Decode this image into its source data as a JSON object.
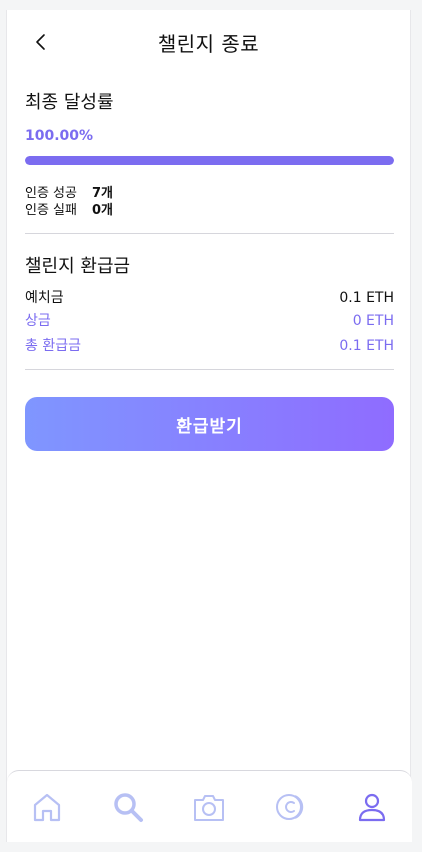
{
  "header": {
    "title": "챌린지 종료"
  },
  "achievement": {
    "heading": "최종 달성률",
    "percent_text": "100.00%",
    "progress_fraction": 1.0,
    "success_label": "인증 성공",
    "success_value": "7개",
    "fail_label": "인증 실패",
    "fail_value": "0개"
  },
  "refund": {
    "heading": "챌린지 환급금",
    "deposit_label": "예치금",
    "deposit_value": "0.1 ETH",
    "prize_label": "상금",
    "prize_value": "0 ETH",
    "total_label": "총 환급금",
    "total_value": "0.1 ETH"
  },
  "refund_button": {
    "label": "환급받기"
  },
  "nav": {
    "items": [
      {
        "icon": "home-icon",
        "active": false
      },
      {
        "icon": "search-icon",
        "active": false
      },
      {
        "icon": "camera-icon",
        "active": false
      },
      {
        "icon": "coin-icon",
        "active": false
      },
      {
        "icon": "profile-icon",
        "active": true
      }
    ]
  },
  "colors": {
    "accent": "#7b6cf0",
    "nav_inactive": "#b7c0f4",
    "gradient_start": "#7f96ff",
    "gradient_end": "#8f6cff"
  }
}
